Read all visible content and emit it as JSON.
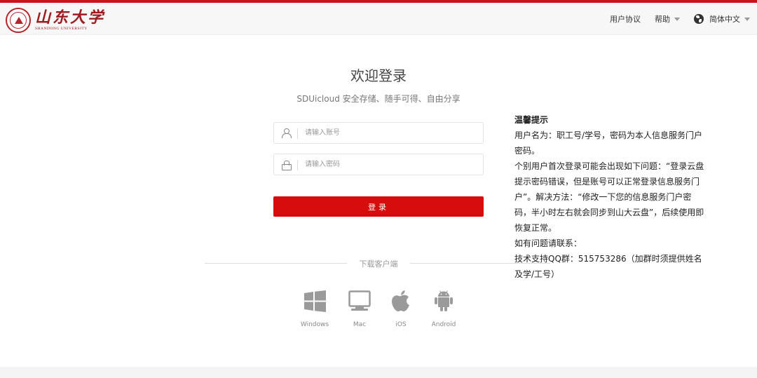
{
  "header": {
    "logo_cn": "山东大学",
    "logo_en": "SHANDONG UNIVERSITY",
    "nav": {
      "user_agreement": "用户协议",
      "help": "帮助",
      "language": "简体中文"
    }
  },
  "login": {
    "title": "欢迎登录",
    "subtitle": "SDUicloud 安全存储、随手可得、自由分享",
    "username_placeholder": "请输入账号",
    "password_placeholder": "请输入密码",
    "submit_label": "登录"
  },
  "download": {
    "label": "下载客户端",
    "clients": [
      {
        "label": "Windows",
        "icon": "windows-icon"
      },
      {
        "label": "Mac",
        "icon": "mac-icon"
      },
      {
        "label": "iOS",
        "icon": "apple-icon"
      },
      {
        "label": "Android",
        "icon": "android-icon"
      }
    ]
  },
  "tips": {
    "title": "温馨提示",
    "lines": [
      "用户名为：职工号/学号，密码为本人信息服务门户密码。",
      "个别用户首次登录可能会出现如下问题：“登录云盘提示密码错误，但是账号可以正常登录信息服务门户”。解决方法：“修改一下您的信息服务门户密码，半小时左右就会同步到山大云盘”，后续使用即恢复正常。",
      "如有问题请联系：",
      "技术支持QQ群：515753286（加群时须提供姓名及学/工号）"
    ]
  },
  "colors": {
    "accent": "#d70c0c",
    "brand": "#9e1b20",
    "top_bar": "#c8141a"
  }
}
